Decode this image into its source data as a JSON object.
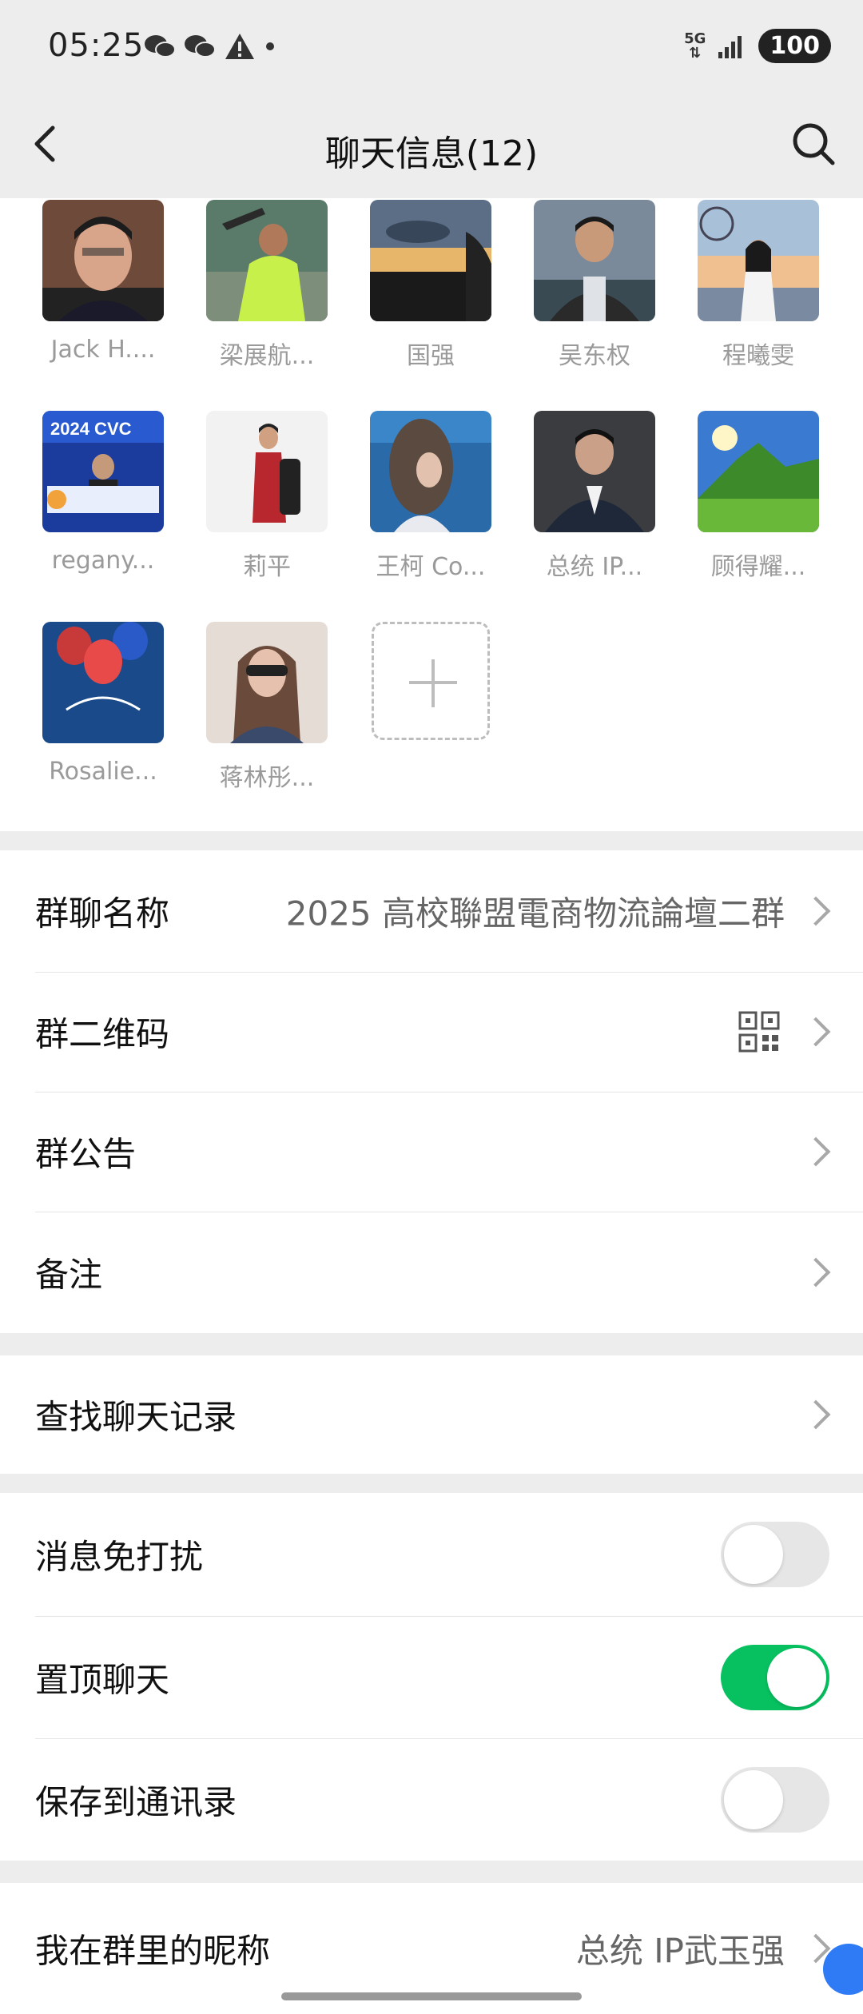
{
  "status_bar": {
    "time": "05:25",
    "network": "5G",
    "battery": "100"
  },
  "nav": {
    "title": "聊天信息(12)"
  },
  "members": [
    {
      "name": "Jack H...."
    },
    {
      "name": "梁展航..."
    },
    {
      "name": "国强"
    },
    {
      "name": "吴东权"
    },
    {
      "name": "程曦雯"
    },
    {
      "name": "regany..."
    },
    {
      "name": "莉平"
    },
    {
      "name": "王柯 Co..."
    },
    {
      "name": "总统 IP..."
    },
    {
      "name": "顾得耀..."
    },
    {
      "name": "Rosalie..."
    },
    {
      "name": "蒋林彤..."
    }
  ],
  "group_info": {
    "name_label": "群聊名称",
    "name_value": "2025 高校聯盟電商物流論壇二群",
    "qr_label": "群二维码",
    "notice_label": "群公告",
    "remark_label": "备注"
  },
  "search_history": {
    "label": "查找聊天记录"
  },
  "toggles": {
    "mute_label": "消息免打扰",
    "mute_on": false,
    "pin_label": "置顶聊天",
    "pin_on": true,
    "save_label": "保存到通讯录",
    "save_on": false
  },
  "nickname": {
    "label": "我在群里的昵称",
    "value": "总统 IP武玉强"
  },
  "colors": {
    "accent": "#07c160",
    "background": "#ededed"
  }
}
